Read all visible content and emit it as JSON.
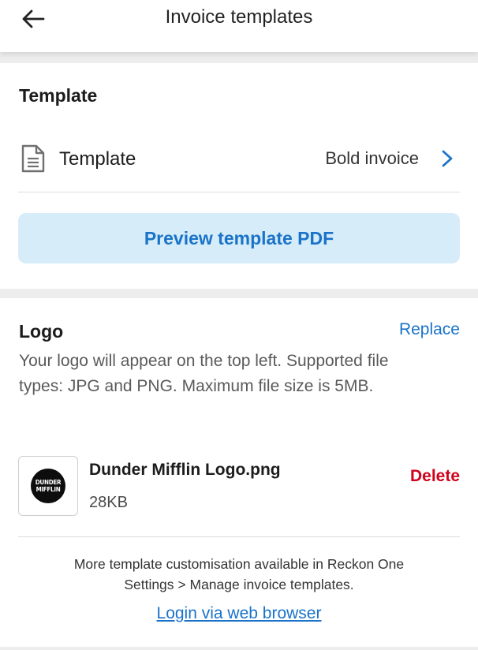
{
  "header": {
    "title": "Invoice templates",
    "back_icon": "arrow-left-icon"
  },
  "template_section": {
    "title": "Template",
    "row_label": "Template",
    "row_value": "Bold invoice",
    "row_icon": "document-icon",
    "preview_button": "Preview template PDF"
  },
  "logo_section": {
    "title": "Logo",
    "replace_label": "Replace",
    "description": "Your logo will appear on the top left. Supported file types: JPG and PNG. Maximum file size is 5MB.",
    "file": {
      "name": "Dunder Mifflin Logo.png",
      "size": "28KB",
      "thumb_text_line1": "DUNDER",
      "thumb_text_line2": "MIFFLIN"
    },
    "delete_label": "Delete"
  },
  "footer": {
    "info_line1": "More template customisation available in Reckon One",
    "info_line2": "Settings > Manage invoice templates.",
    "link": "Login via web browser"
  },
  "colors": {
    "accent": "#1a73c9",
    "accent_bg": "#d6ecf8",
    "danger": "#d0021b",
    "page_bg": "#ededed"
  }
}
